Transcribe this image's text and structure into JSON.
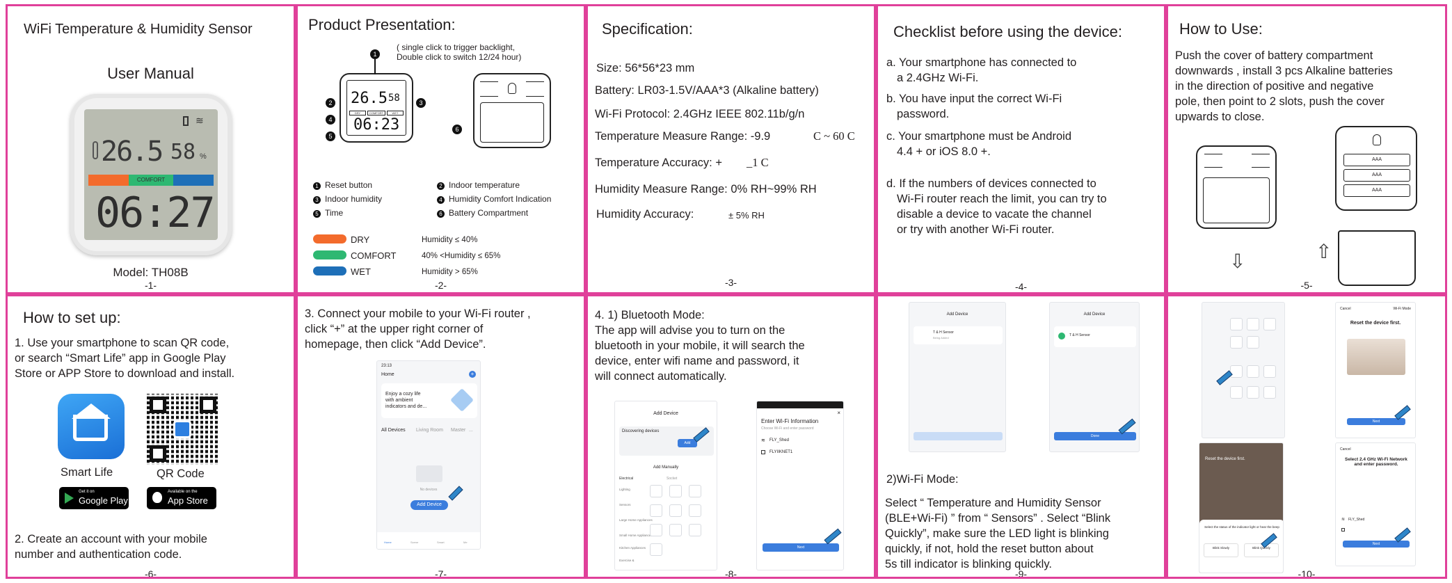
{
  "colors": {
    "border": "#e0409a",
    "dry": "#f36b2c",
    "comfort": "#2eb872",
    "wet": "#1e6fb8",
    "app_blue": "#3b7ddd"
  },
  "p1": {
    "title": "WiFi Temperature & Humidity Sensor",
    "subtitle": "User Manual",
    "lcd_temp": "26.5",
    "lcd_hum": "58",
    "lcd_comfort": "COMFORT",
    "lcd_time": "06:27",
    "model": "Model:  TH08B",
    "page": "-1-"
  },
  "p2": {
    "title": "Product Presentation:",
    "note1": "( single click to trigger backlight,",
    "note2": "Double click to switch 12/24 hour)",
    "lcd_temp": "26.5",
    "lcd_hum": "58",
    "lcd_time": "06:23",
    "lcd_tags": [
      "DRY",
      "COMFORT",
      "WET"
    ],
    "markers": [
      "1",
      "2",
      "3",
      "4",
      "5",
      "6"
    ],
    "legend": [
      {
        "num": "1",
        "text": "Reset button"
      },
      {
        "num": "2",
        "text": "Indoor temperature"
      },
      {
        "num": "3",
        "text": "Indoor humidity"
      },
      {
        "num": "4",
        "text": "Humidity Comfort Indication"
      },
      {
        "num": "5",
        "text": "Time"
      },
      {
        "num": "6",
        "text": "Battery Compartment"
      }
    ],
    "levels": [
      {
        "name": "DRY",
        "range": "Humidity ≤ 40%"
      },
      {
        "name": "COMFORT",
        "range": "40% <Humidity ≤ 65%"
      },
      {
        "name": "WET",
        "range": "Humidity > 65%"
      }
    ],
    "page": "-2-"
  },
  "p3": {
    "title": "Specification:",
    "size": "Size:  56*56*23 mm",
    "battery": "Battery:  LR03-1.5V/AAA*3 (Alkaline battery)",
    "wifi": "Wi-Fi Protocol:  2.4GHz  IEEE 802.11b/g/n",
    "temp_range": "Temperature Measure Range: -9.9",
    "temp_range_b": "C ~ 60 C",
    "temp_acc": "Temperature Accuracy:  +",
    "temp_acc_b": "_1 C",
    "hum_range": "Humidity Measure Range:  0% RH~99% RH",
    "hum_acc": "Humidity Accuracy:",
    "hum_acc_b": "± 5% RH",
    "page": "-3-"
  },
  "p4": {
    "title": "Checklist before using the device:",
    "a1": "a. Your smartphone has connected to",
    "a2": "a 2.4GHz Wi-Fi.",
    "b1": "b. You have input the correct Wi-Fi",
    "b2": "password.",
    "c1": "c. Your smartphone must be Android",
    "c2": "4.4 + or iOS 8.0 +.",
    "d1": "d. If the numbers of devices connected to",
    "d2": "Wi-Fi router reach the limit, you can try to",
    "d3": "disable a device to vacate the channel",
    "d4": "or try with another Wi-Fi router.",
    "page": "-4-"
  },
  "p5": {
    "title": "How to Use:",
    "l1": "Push the cover of battery compartment",
    "l2": "downwards , install 3 pcs Alkaline batteries",
    "l3": "in the direction of positive and negative",
    "l4": "pole, then point to 2 slots, push the cover",
    "l5": "upwards to close.",
    "battery_label": "AAA",
    "page": "-5-"
  },
  "p6": {
    "title": "How to set up:",
    "l1": "1. Use your smartphone to scan QR code,",
    "l2": "or search “Smart Life” app in Google Play",
    "l3": "Store or APP Store to download and install.",
    "app_name": "Smart Life",
    "qr_label": "QR Code",
    "gp_small": "Get it on",
    "gp_big": "Google Play",
    "as_small": "Available on the",
    "as_big": "App Store",
    "l4": "2. Create an account with your mobile",
    "l5": "number and authentication code.",
    "page": "-6-"
  },
  "p7": {
    "l1": "3. Connect your mobile to your Wi-Fi router ,",
    "l2": "click “+” at the upper right corner of",
    "l3": "homepage, then click “Add Device”.",
    "phone_time": "23:13",
    "phone_home": "Home",
    "card_title": "Enjoy a cozy life",
    "card_l2": "with ambient",
    "card_l3": "indicators and de...",
    "tabs": [
      "All Devices",
      "Living Room",
      "Master",
      "..."
    ],
    "no_devices": "No devices",
    "add_device": "Add Device",
    "nav": [
      "Home",
      "Scene",
      "Smart",
      "Me"
    ],
    "page": "-7-"
  },
  "p8": {
    "l1": "4. 1) Bluetooth Mode:",
    "l2": "The app will advise you to turn on the",
    "l3": "bluetooth in your mobile, it will search the",
    "l4": "device, enter wifi name and password, it",
    "l5": "will connect automatically.",
    "add_device": "Add Device",
    "discovering": "Discovering devices",
    "add": "Add",
    "add_manually": "Add Manually",
    "cat_a": "Electrical",
    "cat_b": "Socket",
    "side_cats": [
      "Lighting",
      "Sensors",
      "Large Home Appliances",
      "Small Home Appliances",
      "Kitchen Appliances",
      "Exercise &"
    ],
    "enter_wifi": "Enter Wi-Fi Information",
    "choose_wifi": "Choose Wi-Fi and enter password",
    "ssid": "FLY_Shed",
    "pwd": "FLYIIKNET1",
    "next": "Next",
    "page": "-8-"
  },
  "p9": {
    "add_device": "Add Device",
    "sensor_name": "T & H Sensor",
    "sensor_sub": "Being Added",
    "sensor_name2": "T & H Sensor",
    "done": "Done",
    "h": "2)Wi-Fi Mode:",
    "l1": "Select “ Temperature and Humidity Sensor",
    "l2": "(BLE+Wi-Fi) ” from “ Sensors” . Select “Blink",
    "l3": "Quickly”, make sure the LED light is blinking",
    "l4": "quickly, if not, hold the reset button about",
    "l5": "5s till indicator is blinking quickly.",
    "page": "-9-"
  },
  "p10": {
    "cancel": "Cancel",
    "wifi_mode": "Wi-Fi Mode",
    "reset_first": "Reset the device first.",
    "reset_first2": "Reset the device first.",
    "next": "Next",
    "select_title": "Select 2.4 GHz Wi-Fi Network and enter password.",
    "ssid": "FLY_Shed",
    "status": "Select the status of the indicator light or hear the beep",
    "blink_slow": "Blink Slowly",
    "blink_quick": "Blink Quickly",
    "page": "-10-"
  }
}
